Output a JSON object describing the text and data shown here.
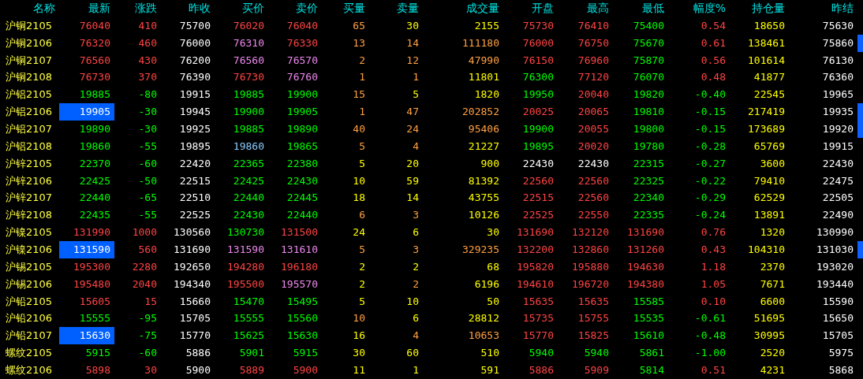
{
  "columns": [
    "名称",
    "最新",
    "涨跌",
    "昨收",
    "买价",
    "卖价",
    "买量",
    "卖量",
    "成交量",
    "开盘",
    "最高",
    "最低",
    "幅度%",
    "持仓量",
    "昨结"
  ],
  "rows": [
    {
      "name": "沪铜2105",
      "selected": false,
      "marked": false,
      "cells": [
        {
          "text": "76040",
          "color": "#ff4444"
        },
        {
          "text": "410",
          "color": "#ff4444"
        },
        {
          "text": "75700",
          "color": "#ffffff"
        },
        {
          "text": "76020",
          "color": "#ff4444"
        },
        {
          "text": "76040",
          "color": "#ff4444"
        },
        {
          "text": "65",
          "color": "#ffa040"
        },
        {
          "text": "30",
          "color": "#ffff00"
        },
        {
          "text": "2155",
          "color": "#ffff00"
        },
        {
          "text": "75730",
          "color": "#ff4444"
        },
        {
          "text": "76410",
          "color": "#ff4444"
        },
        {
          "text": "75400",
          "color": "#00ff00"
        },
        {
          "text": "0.54",
          "color": "#ff4444"
        },
        {
          "text": "18650",
          "color": "#ffff00"
        },
        {
          "text": "75630",
          "color": "#ffffff"
        }
      ]
    },
    {
      "name": "沪铜2106",
      "selected": false,
      "marked": true,
      "cells": [
        {
          "text": "76320",
          "color": "#ff4444"
        },
        {
          "text": "460",
          "color": "#ff4444"
        },
        {
          "text": "76000",
          "color": "#ffffff"
        },
        {
          "text": "76310",
          "color": "#ee88ee"
        },
        {
          "text": "76330",
          "color": "#ff4444"
        },
        {
          "text": "13",
          "color": "#ffa040"
        },
        {
          "text": "14",
          "color": "#ffa040"
        },
        {
          "text": "111180",
          "color": "#ffa040"
        },
        {
          "text": "76000",
          "color": "#ff4444"
        },
        {
          "text": "76750",
          "color": "#ff4444"
        },
        {
          "text": "75670",
          "color": "#00ff00"
        },
        {
          "text": "0.61",
          "color": "#ff4444"
        },
        {
          "text": "138461",
          "color": "#ffff00"
        },
        {
          "text": "75860",
          "color": "#ffffff"
        }
      ]
    },
    {
      "name": "沪铜2107",
      "selected": false,
      "marked": false,
      "cells": [
        {
          "text": "76560",
          "color": "#ff4444"
        },
        {
          "text": "430",
          "color": "#ff4444"
        },
        {
          "text": "76200",
          "color": "#ffffff"
        },
        {
          "text": "76560",
          "color": "#ee88ee"
        },
        {
          "text": "76570",
          "color": "#ee88ee"
        },
        {
          "text": "2",
          "color": "#ffa040"
        },
        {
          "text": "12",
          "color": "#ffa040"
        },
        {
          "text": "47990",
          "color": "#ffa040"
        },
        {
          "text": "76150",
          "color": "#ff4444"
        },
        {
          "text": "76960",
          "color": "#ff4444"
        },
        {
          "text": "75870",
          "color": "#00ff00"
        },
        {
          "text": "0.56",
          "color": "#ff4444"
        },
        {
          "text": "101614",
          "color": "#ffff00"
        },
        {
          "text": "76130",
          "color": "#ffffff"
        }
      ]
    },
    {
      "name": "沪铜2108",
      "selected": false,
      "marked": false,
      "cells": [
        {
          "text": "76730",
          "color": "#ff4444"
        },
        {
          "text": "370",
          "color": "#ff4444"
        },
        {
          "text": "76390",
          "color": "#ffffff"
        },
        {
          "text": "76730",
          "color": "#ff4444"
        },
        {
          "text": "76760",
          "color": "#ee88ee"
        },
        {
          "text": "1",
          "color": "#ffa040"
        },
        {
          "text": "1",
          "color": "#ffa040"
        },
        {
          "text": "11801",
          "color": "#ffff00"
        },
        {
          "text": "76300",
          "color": "#00ff00"
        },
        {
          "text": "77120",
          "color": "#ff4444"
        },
        {
          "text": "76070",
          "color": "#00ff00"
        },
        {
          "text": "0.48",
          "color": "#ff4444"
        },
        {
          "text": "41877",
          "color": "#ffff00"
        },
        {
          "text": "76360",
          "color": "#ffffff"
        }
      ]
    },
    {
      "name": "沪铝2105",
      "selected": false,
      "marked": false,
      "cells": [
        {
          "text": "19885",
          "color": "#00ff00"
        },
        {
          "text": "-80",
          "color": "#00ff00"
        },
        {
          "text": "19915",
          "color": "#ffffff"
        },
        {
          "text": "19885",
          "color": "#00ff00"
        },
        {
          "text": "19900",
          "color": "#00ff00"
        },
        {
          "text": "15",
          "color": "#ffa040"
        },
        {
          "text": "5",
          "color": "#ffff00"
        },
        {
          "text": "1820",
          "color": "#ffff00"
        },
        {
          "text": "19950",
          "color": "#00ff00"
        },
        {
          "text": "20040",
          "color": "#ff4444"
        },
        {
          "text": "19820",
          "color": "#00ff00"
        },
        {
          "text": "-0.40",
          "color": "#00ff00"
        },
        {
          "text": "22545",
          "color": "#ffff00"
        },
        {
          "text": "19965",
          "color": "#ffffff"
        }
      ]
    },
    {
      "name": "沪铝2106",
      "selected": true,
      "marked": true,
      "cells": [
        {
          "text": "19905",
          "color": "#ffffff"
        },
        {
          "text": "-30",
          "color": "#00ff00"
        },
        {
          "text": "19945",
          "color": "#ffffff"
        },
        {
          "text": "19900",
          "color": "#00ff00"
        },
        {
          "text": "19905",
          "color": "#00ff00"
        },
        {
          "text": "1",
          "color": "#ffa040"
        },
        {
          "text": "47",
          "color": "#ffa040"
        },
        {
          "text": "202852",
          "color": "#ffa040"
        },
        {
          "text": "20025",
          "color": "#ff4444"
        },
        {
          "text": "20065",
          "color": "#ff4444"
        },
        {
          "text": "19810",
          "color": "#00ff00"
        },
        {
          "text": "-0.15",
          "color": "#00ff00"
        },
        {
          "text": "217419",
          "color": "#ffff00"
        },
        {
          "text": "19935",
          "color": "#ffffff"
        }
      ]
    },
    {
      "name": "沪铝2107",
      "selected": false,
      "marked": true,
      "cells": [
        {
          "text": "19890",
          "color": "#00ff00"
        },
        {
          "text": "-30",
          "color": "#00ff00"
        },
        {
          "text": "19925",
          "color": "#ffffff"
        },
        {
          "text": "19885",
          "color": "#00ff00"
        },
        {
          "text": "19890",
          "color": "#00ff00"
        },
        {
          "text": "40",
          "color": "#ffa040"
        },
        {
          "text": "24",
          "color": "#ffa040"
        },
        {
          "text": "95406",
          "color": "#ffa040"
        },
        {
          "text": "19900",
          "color": "#00ff00"
        },
        {
          "text": "20055",
          "color": "#ff4444"
        },
        {
          "text": "19800",
          "color": "#00ff00"
        },
        {
          "text": "-0.15",
          "color": "#00ff00"
        },
        {
          "text": "173689",
          "color": "#ffff00"
        },
        {
          "text": "19920",
          "color": "#ffffff"
        }
      ]
    },
    {
      "name": "沪铝2108",
      "selected": false,
      "marked": false,
      "cells": [
        {
          "text": "19860",
          "color": "#00ff00"
        },
        {
          "text": "-55",
          "color": "#00ff00"
        },
        {
          "text": "19895",
          "color": "#ffffff"
        },
        {
          "text": "19860",
          "color": "#88ccff"
        },
        {
          "text": "19865",
          "color": "#00ff00"
        },
        {
          "text": "5",
          "color": "#ffa040"
        },
        {
          "text": "4",
          "color": "#ffa040"
        },
        {
          "text": "21227",
          "color": "#ffff00"
        },
        {
          "text": "19895",
          "color": "#00ff00"
        },
        {
          "text": "20020",
          "color": "#ff4444"
        },
        {
          "text": "19780",
          "color": "#00ff00"
        },
        {
          "text": "-0.28",
          "color": "#00ff00"
        },
        {
          "text": "65769",
          "color": "#ffff00"
        },
        {
          "text": "19915",
          "color": "#ffffff"
        }
      ]
    },
    {
      "name": "沪锌2105",
      "selected": false,
      "marked": false,
      "cells": [
        {
          "text": "22370",
          "color": "#00ff00"
        },
        {
          "text": "-60",
          "color": "#00ff00"
        },
        {
          "text": "22420",
          "color": "#ffffff"
        },
        {
          "text": "22365",
          "color": "#00ff00"
        },
        {
          "text": "22380",
          "color": "#00ff00"
        },
        {
          "text": "5",
          "color": "#ffff00"
        },
        {
          "text": "20",
          "color": "#ffff00"
        },
        {
          "text": "900",
          "color": "#ffff00"
        },
        {
          "text": "22430",
          "color": "#ffffff"
        },
        {
          "text": "22430",
          "color": "#ffffff"
        },
        {
          "text": "22315",
          "color": "#00ff00"
        },
        {
          "text": "-0.27",
          "color": "#00ff00"
        },
        {
          "text": "3600",
          "color": "#ffff00"
        },
        {
          "text": "22430",
          "color": "#ffffff"
        }
      ]
    },
    {
      "name": "沪锌2106",
      "selected": false,
      "marked": false,
      "cells": [
        {
          "text": "22425",
          "color": "#00ff00"
        },
        {
          "text": "-50",
          "color": "#00ff00"
        },
        {
          "text": "22515",
          "color": "#ffffff"
        },
        {
          "text": "22425",
          "color": "#00ff00"
        },
        {
          "text": "22430",
          "color": "#00ff00"
        },
        {
          "text": "10",
          "color": "#ffff00"
        },
        {
          "text": "59",
          "color": "#ffff00"
        },
        {
          "text": "81392",
          "color": "#ffff00"
        },
        {
          "text": "22560",
          "color": "#ff4444"
        },
        {
          "text": "22560",
          "color": "#ff4444"
        },
        {
          "text": "22325",
          "color": "#00ff00"
        },
        {
          "text": "-0.22",
          "color": "#00ff00"
        },
        {
          "text": "79410",
          "color": "#ffff00"
        },
        {
          "text": "22475",
          "color": "#ffffff"
        }
      ]
    },
    {
      "name": "沪锌2107",
      "selected": false,
      "marked": false,
      "cells": [
        {
          "text": "22440",
          "color": "#00ff00"
        },
        {
          "text": "-65",
          "color": "#00ff00"
        },
        {
          "text": "22510",
          "color": "#ffffff"
        },
        {
          "text": "22440",
          "color": "#00ff00"
        },
        {
          "text": "22445",
          "color": "#00ff00"
        },
        {
          "text": "18",
          "color": "#ffff00"
        },
        {
          "text": "14",
          "color": "#ffff00"
        },
        {
          "text": "43755",
          "color": "#ffff00"
        },
        {
          "text": "22515",
          "color": "#ff4444"
        },
        {
          "text": "22560",
          "color": "#ff4444"
        },
        {
          "text": "22340",
          "color": "#00ff00"
        },
        {
          "text": "-0.29",
          "color": "#00ff00"
        },
        {
          "text": "62529",
          "color": "#ffff00"
        },
        {
          "text": "22505",
          "color": "#ffffff"
        }
      ]
    },
    {
      "name": "沪锌2108",
      "selected": false,
      "marked": false,
      "cells": [
        {
          "text": "22435",
          "color": "#00ff00"
        },
        {
          "text": "-55",
          "color": "#00ff00"
        },
        {
          "text": "22525",
          "color": "#ffffff"
        },
        {
          "text": "22430",
          "color": "#00ff00"
        },
        {
          "text": "22440",
          "color": "#00ff00"
        },
        {
          "text": "6",
          "color": "#ffa040"
        },
        {
          "text": "3",
          "color": "#ffa040"
        },
        {
          "text": "10126",
          "color": "#ffff00"
        },
        {
          "text": "22525",
          "color": "#ff4444"
        },
        {
          "text": "22550",
          "color": "#ff4444"
        },
        {
          "text": "22335",
          "color": "#00ff00"
        },
        {
          "text": "-0.24",
          "color": "#00ff00"
        },
        {
          "text": "13891",
          "color": "#ffff00"
        },
        {
          "text": "22490",
          "color": "#ffffff"
        }
      ]
    },
    {
      "name": "沪镍2105",
      "selected": false,
      "marked": false,
      "cells": [
        {
          "text": "131990",
          "color": "#ff4444"
        },
        {
          "text": "1000",
          "color": "#ff4444"
        },
        {
          "text": "130560",
          "color": "#ffffff"
        },
        {
          "text": "130730",
          "color": "#00ff00"
        },
        {
          "text": "131500",
          "color": "#ff4444"
        },
        {
          "text": "24",
          "color": "#ffff00"
        },
        {
          "text": "6",
          "color": "#ffff00"
        },
        {
          "text": "30",
          "color": "#ffff00"
        },
        {
          "text": "131690",
          "color": "#ff4444"
        },
        {
          "text": "132120",
          "color": "#ff4444"
        },
        {
          "text": "131690",
          "color": "#ff4444"
        },
        {
          "text": "0.76",
          "color": "#ff4444"
        },
        {
          "text": "1320",
          "color": "#ffff00"
        },
        {
          "text": "130990",
          "color": "#ffffff"
        }
      ]
    },
    {
      "name": "沪镍2106",
      "selected": true,
      "marked": true,
      "cells": [
        {
          "text": "131590",
          "color": "#ffffff"
        },
        {
          "text": "560",
          "color": "#ff4444"
        },
        {
          "text": "131690",
          "color": "#ffffff"
        },
        {
          "text": "131590",
          "color": "#ee88ee"
        },
        {
          "text": "131610",
          "color": "#ee88ee"
        },
        {
          "text": "5",
          "color": "#ffa040"
        },
        {
          "text": "3",
          "color": "#ffa040"
        },
        {
          "text": "329235",
          "color": "#ffa040"
        },
        {
          "text": "132200",
          "color": "#ff4444"
        },
        {
          "text": "132860",
          "color": "#ff4444"
        },
        {
          "text": "131260",
          "color": "#ff4444"
        },
        {
          "text": "0.43",
          "color": "#ff4444"
        },
        {
          "text": "104310",
          "color": "#ffff00"
        },
        {
          "text": "131030",
          "color": "#ffffff"
        }
      ]
    },
    {
      "name": "沪锡2105",
      "selected": false,
      "marked": false,
      "cells": [
        {
          "text": "195300",
          "color": "#ff4444"
        },
        {
          "text": "2280",
          "color": "#ff4444"
        },
        {
          "text": "192650",
          "color": "#ffffff"
        },
        {
          "text": "194280",
          "color": "#ff4444"
        },
        {
          "text": "196180",
          "color": "#ff4444"
        },
        {
          "text": "2",
          "color": "#ffff00"
        },
        {
          "text": "2",
          "color": "#ffff00"
        },
        {
          "text": "68",
          "color": "#ffff00"
        },
        {
          "text": "195820",
          "color": "#ff4444"
        },
        {
          "text": "195880",
          "color": "#ff4444"
        },
        {
          "text": "194630",
          "color": "#ff4444"
        },
        {
          "text": "1.18",
          "color": "#ff4444"
        },
        {
          "text": "2370",
          "color": "#ffff00"
        },
        {
          "text": "193020",
          "color": "#ffffff"
        }
      ]
    },
    {
      "name": "沪锡2106",
      "selected": false,
      "marked": false,
      "cells": [
        {
          "text": "195480",
          "color": "#ff4444"
        },
        {
          "text": "2040",
          "color": "#ff4444"
        },
        {
          "text": "194340",
          "color": "#ffffff"
        },
        {
          "text": "195500",
          "color": "#ff4444"
        },
        {
          "text": "195570",
          "color": "#ee88ee"
        },
        {
          "text": "2",
          "color": "#ffff00"
        },
        {
          "text": "2",
          "color": "#ffa040"
        },
        {
          "text": "6196",
          "color": "#ffff00"
        },
        {
          "text": "194610",
          "color": "#ff4444"
        },
        {
          "text": "196720",
          "color": "#ff4444"
        },
        {
          "text": "194380",
          "color": "#ff4444"
        },
        {
          "text": "1.05",
          "color": "#ff4444"
        },
        {
          "text": "7671",
          "color": "#ffff00"
        },
        {
          "text": "193440",
          "color": "#ffffff"
        }
      ]
    },
    {
      "name": "沪铅2105",
      "selected": false,
      "marked": false,
      "cells": [
        {
          "text": "15605",
          "color": "#ff4444"
        },
        {
          "text": "15",
          "color": "#ff4444"
        },
        {
          "text": "15660",
          "color": "#ffffff"
        },
        {
          "text": "15470",
          "color": "#00ff00"
        },
        {
          "text": "15495",
          "color": "#00ff00"
        },
        {
          "text": "5",
          "color": "#ffff00"
        },
        {
          "text": "10",
          "color": "#ffff00"
        },
        {
          "text": "50",
          "color": "#ffff00"
        },
        {
          "text": "15635",
          "color": "#ff4444"
        },
        {
          "text": "15635",
          "color": "#ff4444"
        },
        {
          "text": "15585",
          "color": "#00ff00"
        },
        {
          "text": "0.10",
          "color": "#ff4444"
        },
        {
          "text": "6600",
          "color": "#ffff00"
        },
        {
          "text": "15590",
          "color": "#ffffff"
        }
      ]
    },
    {
      "name": "沪铅2106",
      "selected": false,
      "marked": false,
      "cells": [
        {
          "text": "15555",
          "color": "#00ff00"
        },
        {
          "text": "-95",
          "color": "#00ff00"
        },
        {
          "text": "15705",
          "color": "#ffffff"
        },
        {
          "text": "15555",
          "color": "#00ff00"
        },
        {
          "text": "15560",
          "color": "#00ff00"
        },
        {
          "text": "10",
          "color": "#ffa040"
        },
        {
          "text": "6",
          "color": "#ffff00"
        },
        {
          "text": "28812",
          "color": "#ffff00"
        },
        {
          "text": "15735",
          "color": "#ff4444"
        },
        {
          "text": "15755",
          "color": "#ff4444"
        },
        {
          "text": "15535",
          "color": "#00ff00"
        },
        {
          "text": "-0.61",
          "color": "#00ff00"
        },
        {
          "text": "51695",
          "color": "#ffff00"
        },
        {
          "text": "15650",
          "color": "#ffffff"
        }
      ]
    },
    {
      "name": "沪铅2107",
      "selected": true,
      "marked": false,
      "cells": [
        {
          "text": "15630",
          "color": "#ffffff"
        },
        {
          "text": "-75",
          "color": "#00ff00"
        },
        {
          "text": "15770",
          "color": "#ffffff"
        },
        {
          "text": "15625",
          "color": "#00ff00"
        },
        {
          "text": "15630",
          "color": "#00ff00"
        },
        {
          "text": "16",
          "color": "#ffff00"
        },
        {
          "text": "4",
          "color": "#ffa040"
        },
        {
          "text": "10653",
          "color": "#ffa040"
        },
        {
          "text": "15770",
          "color": "#ff4444"
        },
        {
          "text": "15825",
          "color": "#ff4444"
        },
        {
          "text": "15610",
          "color": "#00ff00"
        },
        {
          "text": "-0.48",
          "color": "#00ff00"
        },
        {
          "text": "30995",
          "color": "#ffff00"
        },
        {
          "text": "15705",
          "color": "#ffffff"
        }
      ]
    },
    {
      "name": "螺纹2105",
      "selected": false,
      "marked": false,
      "cells": [
        {
          "text": "5915",
          "color": "#00ff00"
        },
        {
          "text": "-60",
          "color": "#00ff00"
        },
        {
          "text": "5886",
          "color": "#ffffff"
        },
        {
          "text": "5901",
          "color": "#00ff00"
        },
        {
          "text": "5915",
          "color": "#00ff00"
        },
        {
          "text": "30",
          "color": "#ffff00"
        },
        {
          "text": "60",
          "color": "#ffff00"
        },
        {
          "text": "510",
          "color": "#ffff00"
        },
        {
          "text": "5940",
          "color": "#00ff00"
        },
        {
          "text": "5940",
          "color": "#00ff00"
        },
        {
          "text": "5861",
          "color": "#00ff00"
        },
        {
          "text": "-1.00",
          "color": "#00ff00"
        },
        {
          "text": "2520",
          "color": "#ffff00"
        },
        {
          "text": "5975",
          "color": "#ffffff"
        }
      ]
    },
    {
      "name": "螺纹2106",
      "selected": false,
      "marked": false,
      "cells": [
        {
          "text": "5898",
          "color": "#ff4444"
        },
        {
          "text": "30",
          "color": "#ff4444"
        },
        {
          "text": "5900",
          "color": "#ffffff"
        },
        {
          "text": "5889",
          "color": "#ff4444"
        },
        {
          "text": "5900",
          "color": "#ff4444"
        },
        {
          "text": "11",
          "color": "#ffff00"
        },
        {
          "text": "1",
          "color": "#ffff00"
        },
        {
          "text": "591",
          "color": "#ffff00"
        },
        {
          "text": "5886",
          "color": "#ff4444"
        },
        {
          "text": "5909",
          "color": "#ff4444"
        },
        {
          "text": "5814",
          "color": "#00ff00"
        },
        {
          "text": "0.51",
          "color": "#ff4444"
        },
        {
          "text": "4231",
          "color": "#ffff00"
        },
        {
          "text": "5868",
          "color": "#ffffff"
        }
      ]
    }
  ]
}
